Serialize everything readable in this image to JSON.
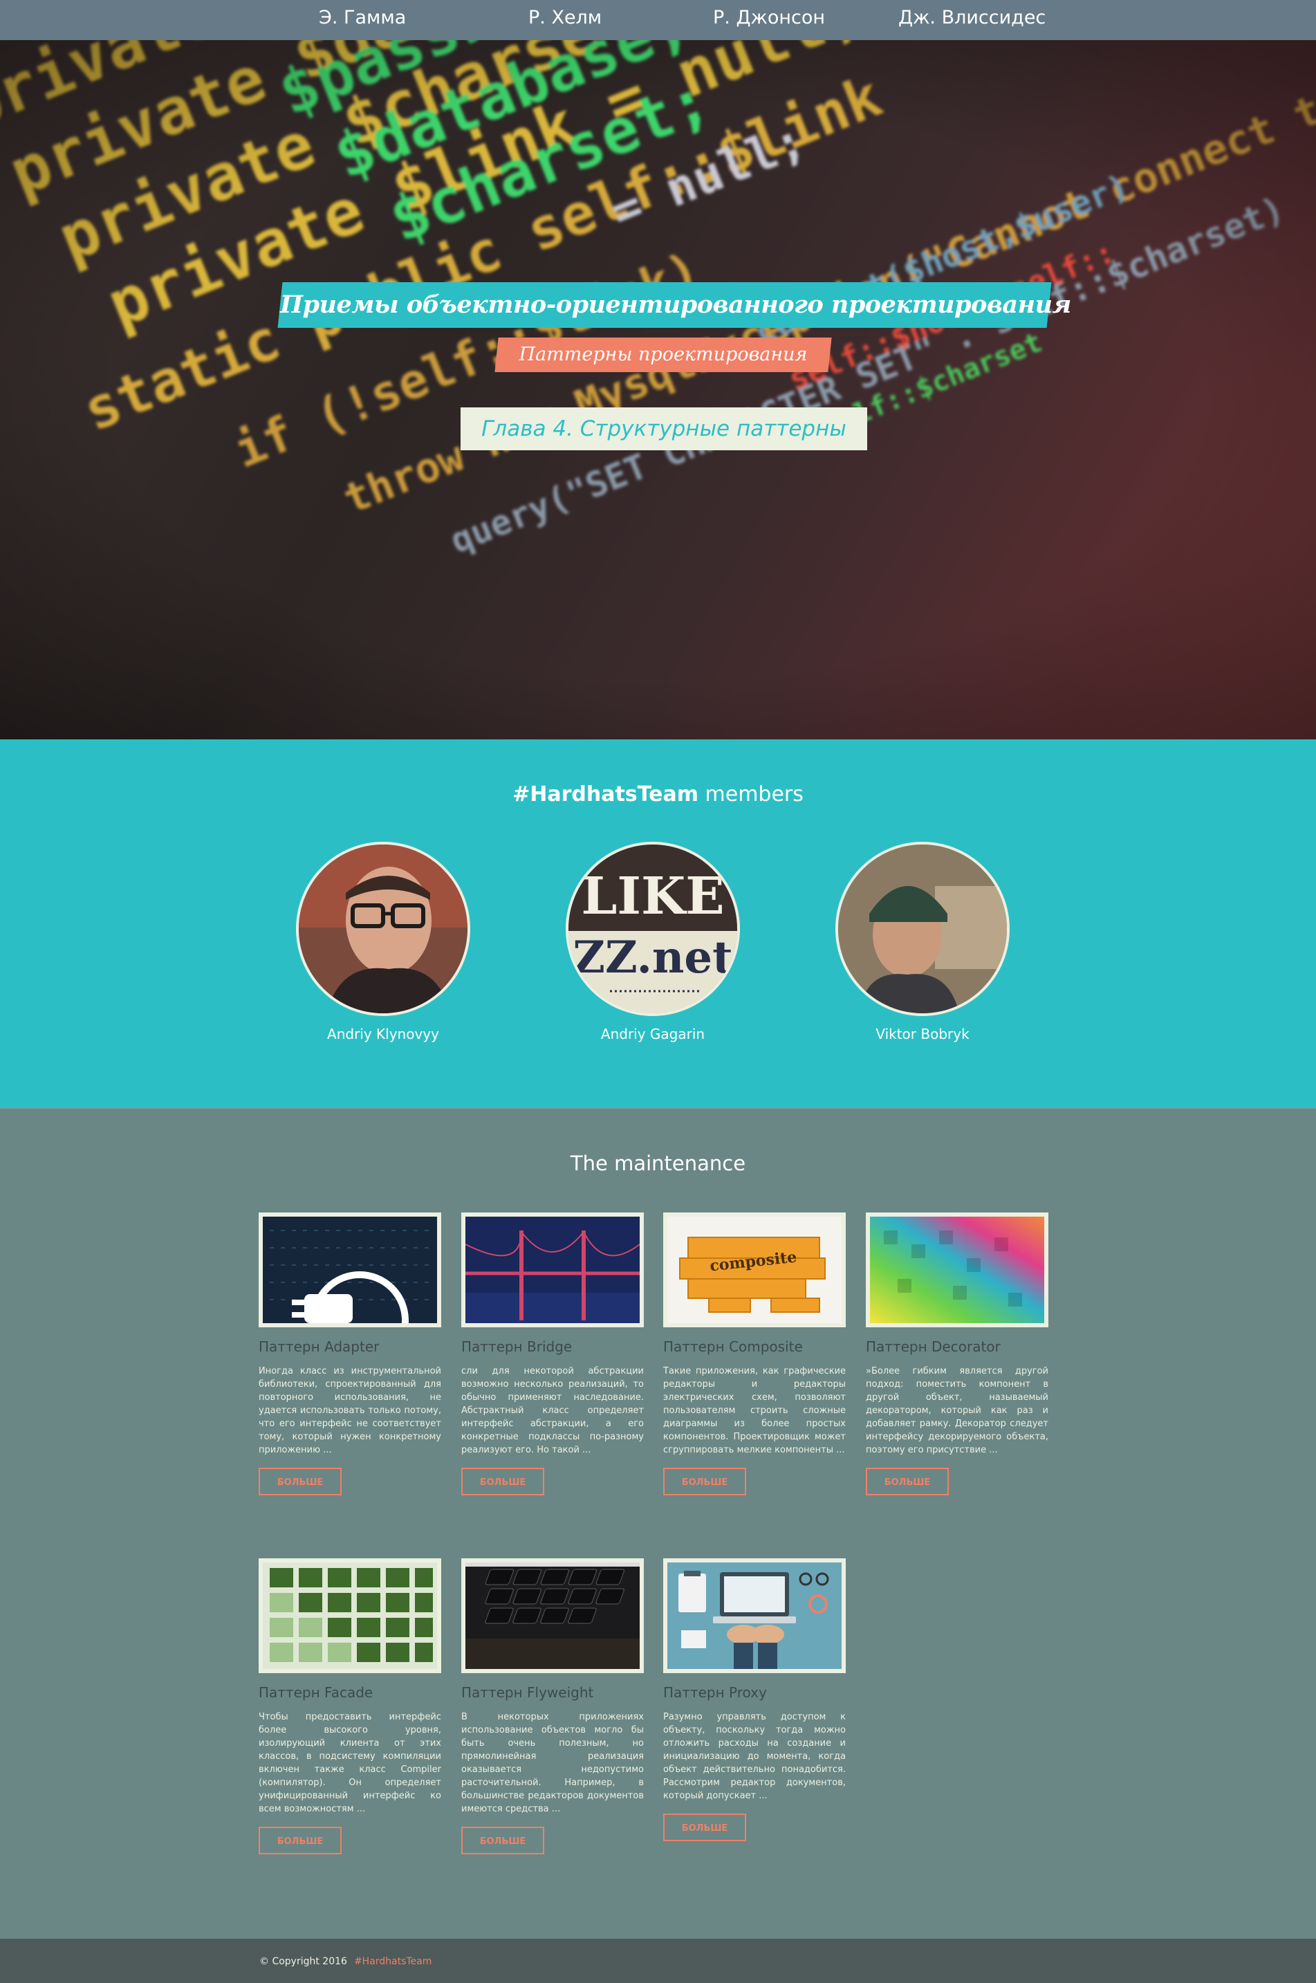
{
  "nav": {
    "items": [
      {
        "label": "Э. Гамма"
      },
      {
        "label": "Р. Хелм"
      },
      {
        "label": "Р. Джонсон"
      },
      {
        "label": "Дж. Влиссидес"
      }
    ]
  },
  "hero": {
    "title": "Приемы объектно-ориентированного проектирования",
    "subtitle": "Паттерны проектирования",
    "chapter": "Глава 4. Структурные паттерны",
    "code_lines": [
      "private $password;",
      "private $database;",
      "private $charset;",
      "private $link = null;",
      "static public self::$link",
      "if (!self::$link)",
      "throw new MysqlException(\"Cannot connect to db\")",
      "query(\"SET CHARACTER SET\" . self::$charset)"
    ]
  },
  "team": {
    "title_bold": "#HardhatsTeam",
    "title_rest": " members",
    "members": [
      {
        "name": "Andriy Klynovyy"
      },
      {
        "name": "Andriy Gagarin",
        "logo_line1": "LIKE",
        "logo_line2": "ZZ.net"
      },
      {
        "name": "Viktor Bobryk"
      }
    ]
  },
  "maintenance": {
    "title": "The maintenance",
    "more_label": "БОЛЬШЕ",
    "cards": [
      {
        "title": "Паттерн Adapter",
        "desc": "Иногда класс из инструментальной библиотеки, спроектированный для повторного использования, не удается использовать только потому, что его интерфейс не соответствует тому, который нужен конкретному приложению ..."
      },
      {
        "title": "Паттерн Bridge",
        "desc": "сли для некоторой абстракции возможно несколько реализаций, то обычно применяют наследование. Абстрактный класс определяет интерфейс абстракции, а его конкретные подклассы по-разному реализуют его. Но такой ..."
      },
      {
        "title": "Паттерн Composite",
        "desc": "Такие приложения, как графические редакторы и редакторы электрических схем, позволяют пользователям строить сложные диаграммы из более простых компонентов. Проектировщик может сгруппировать мелкие компоненты ...",
        "image_text": "composite"
      },
      {
        "title": "Паттерн Decorator",
        "desc": "»Более гибким является другой подход: поместить компонент в другой объект, называемый декоратором, который как раз и добавляет рамку. Декоратор следует интерфейсу декорируемого объекта, поэтому его присутствие ..."
      },
      {
        "title": "Паттерн Facade",
        "desc": "Чтобы предоставить интерфейс более высокого уровня, изолирующий клиента от этих классов, в подсистему компиляции включен также класс Compiler (компилятор). Он определяет унифицированный интерфейс ко всем возможностям ..."
      },
      {
        "title": "Паттерн Flyweight",
        "desc": "В некоторых приложениях использование объектов могло бы быть очень полезным, но прямолинейная реализация оказывается недопустимо расточительной. Например, в большинстве редакторов документов имеются средства ..."
      },
      {
        "title": "Паттерн Proxy",
        "desc": "Разумно управлять доступом к объекту, поскольку тогда можно отложить расходы на создание и инициализацию до момента, когда объект действительно понадобится. Рассмотрим редактор документов, который допускает ..."
      }
    ]
  },
  "footer": {
    "copyright": "© Copyright 2016",
    "tag": "#HardhatsTeam"
  },
  "colors": {
    "teal": "#2bbfc5",
    "coral": "#f08066",
    "slate": "#6a8785",
    "cream": "#ecf0e1",
    "nav_bg": "#667b87",
    "footer_bg": "#4f5a5a"
  }
}
